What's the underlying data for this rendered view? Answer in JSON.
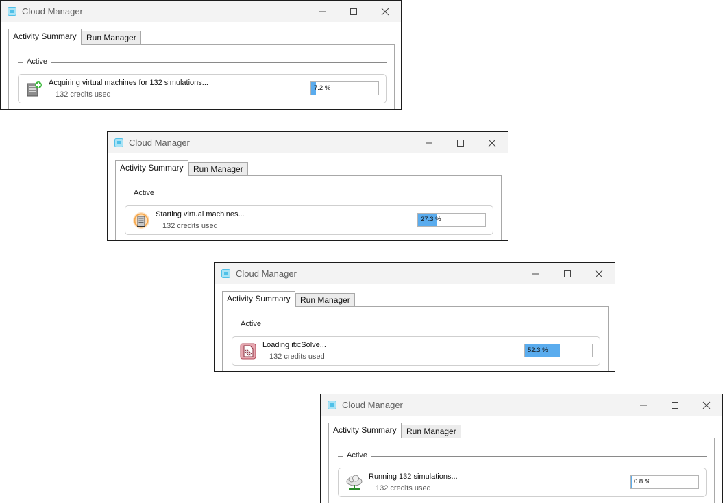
{
  "app": {
    "title": "Cloud Manager"
  },
  "tabs": {
    "active": "Activity Summary",
    "inactive": "Run Manager"
  },
  "group_label": "Active",
  "windows": [
    {
      "status_icon": "server-add-icon",
      "status": "Acquiring virtual machines for 132 simulations...",
      "credits": "132 credits used",
      "progress_label": "7.2 %",
      "progress": 7.2
    },
    {
      "status_icon": "server-starting-icon",
      "status": "Starting virtual machines...",
      "credits": "132 credits used",
      "progress_label": "27.3 %",
      "progress": 27.3
    },
    {
      "status_icon": "document-loading-icon",
      "status": "Loading ifx:Solve...",
      "credits": "132 credits used",
      "progress_label": "52.3 %",
      "progress": 52.3
    },
    {
      "status_icon": "cloud-running-icon",
      "status": "Running 132 simulations...",
      "credits": "132 credits used",
      "progress_label": "0.8 %",
      "progress": 0.8
    }
  ],
  "colors": {
    "progress_fill": "#5aacee",
    "app_icon": "#4fc0e8",
    "titlebar": "#f3f3f3"
  }
}
